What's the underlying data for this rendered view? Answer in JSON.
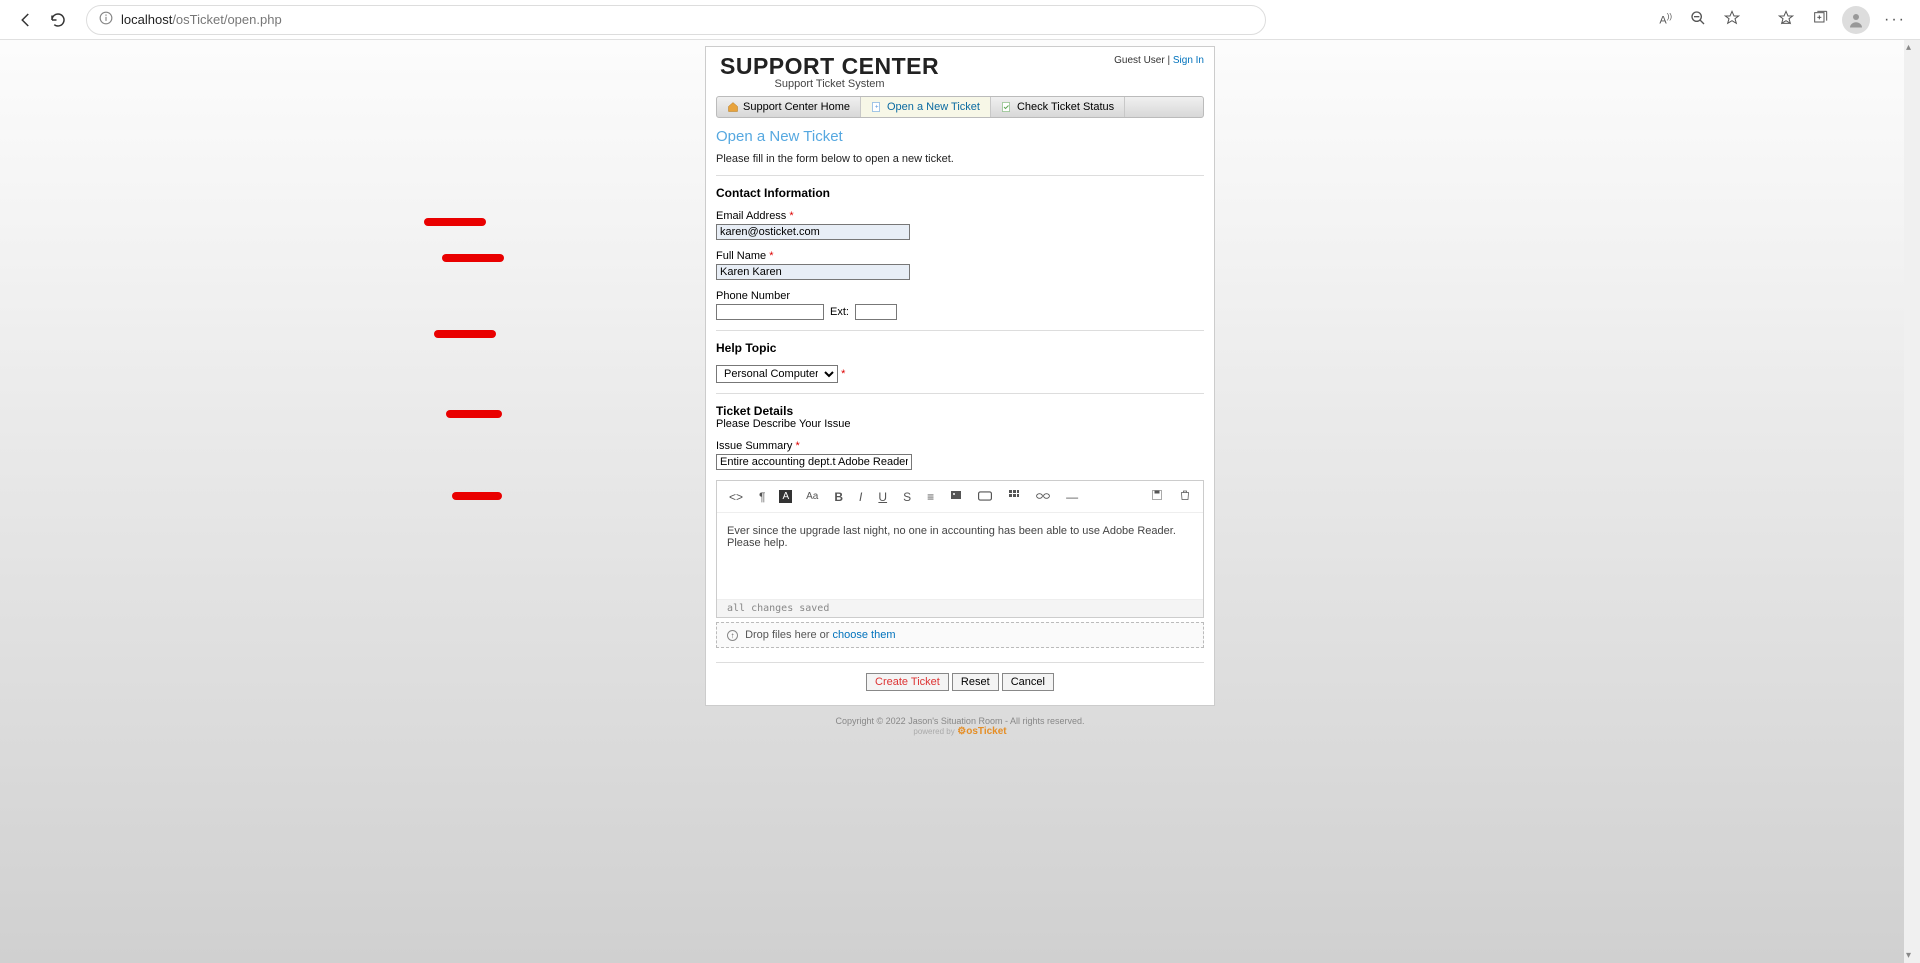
{
  "browser": {
    "url_host": "localhost",
    "url_path": "/osTicket/open.php"
  },
  "header": {
    "logo_title": "SUPPORT CENTER",
    "logo_subtitle": "Support Ticket System",
    "guest_label": "Guest User",
    "sep": " | ",
    "signin": "Sign In"
  },
  "nav": {
    "home": "Support Center Home",
    "open": "Open a New Ticket",
    "status": "Check Ticket Status"
  },
  "page": {
    "title": "Open a New Ticket",
    "intro": "Please fill in the form below to open a new ticket."
  },
  "contact": {
    "section": "Contact Information",
    "email_label": "Email Address",
    "email_value": "karen@osticket.com",
    "name_label": "Full Name",
    "name_value": "Karen Karen",
    "phone_label": "Phone Number",
    "phone_value": "",
    "ext_label": "Ext:",
    "ext_value": ""
  },
  "topic": {
    "label": "Help Topic",
    "selected": "Personal Computer Issues"
  },
  "details": {
    "section": "Ticket Details",
    "desc": "Please Describe Your Issue",
    "summary_label": "Issue Summary",
    "summary_value": "Entire accounting dept.t Adobe Reader not workin"
  },
  "editor": {
    "body": "Ever since the upgrade last night, no one in accounting has been able to use Adobe Reader. Please help.",
    "status": "all changes saved"
  },
  "dropzone": {
    "prefix": "Drop files here or ",
    "link": "choose them"
  },
  "buttons": {
    "create": "Create Ticket",
    "reset": "Reset",
    "cancel": "Cancel"
  },
  "footer": {
    "copyright": "Copyright © 2022 Jason's Situation Room - All rights reserved.",
    "powered": "powered by",
    "brand": "osTicket"
  },
  "req": "*"
}
